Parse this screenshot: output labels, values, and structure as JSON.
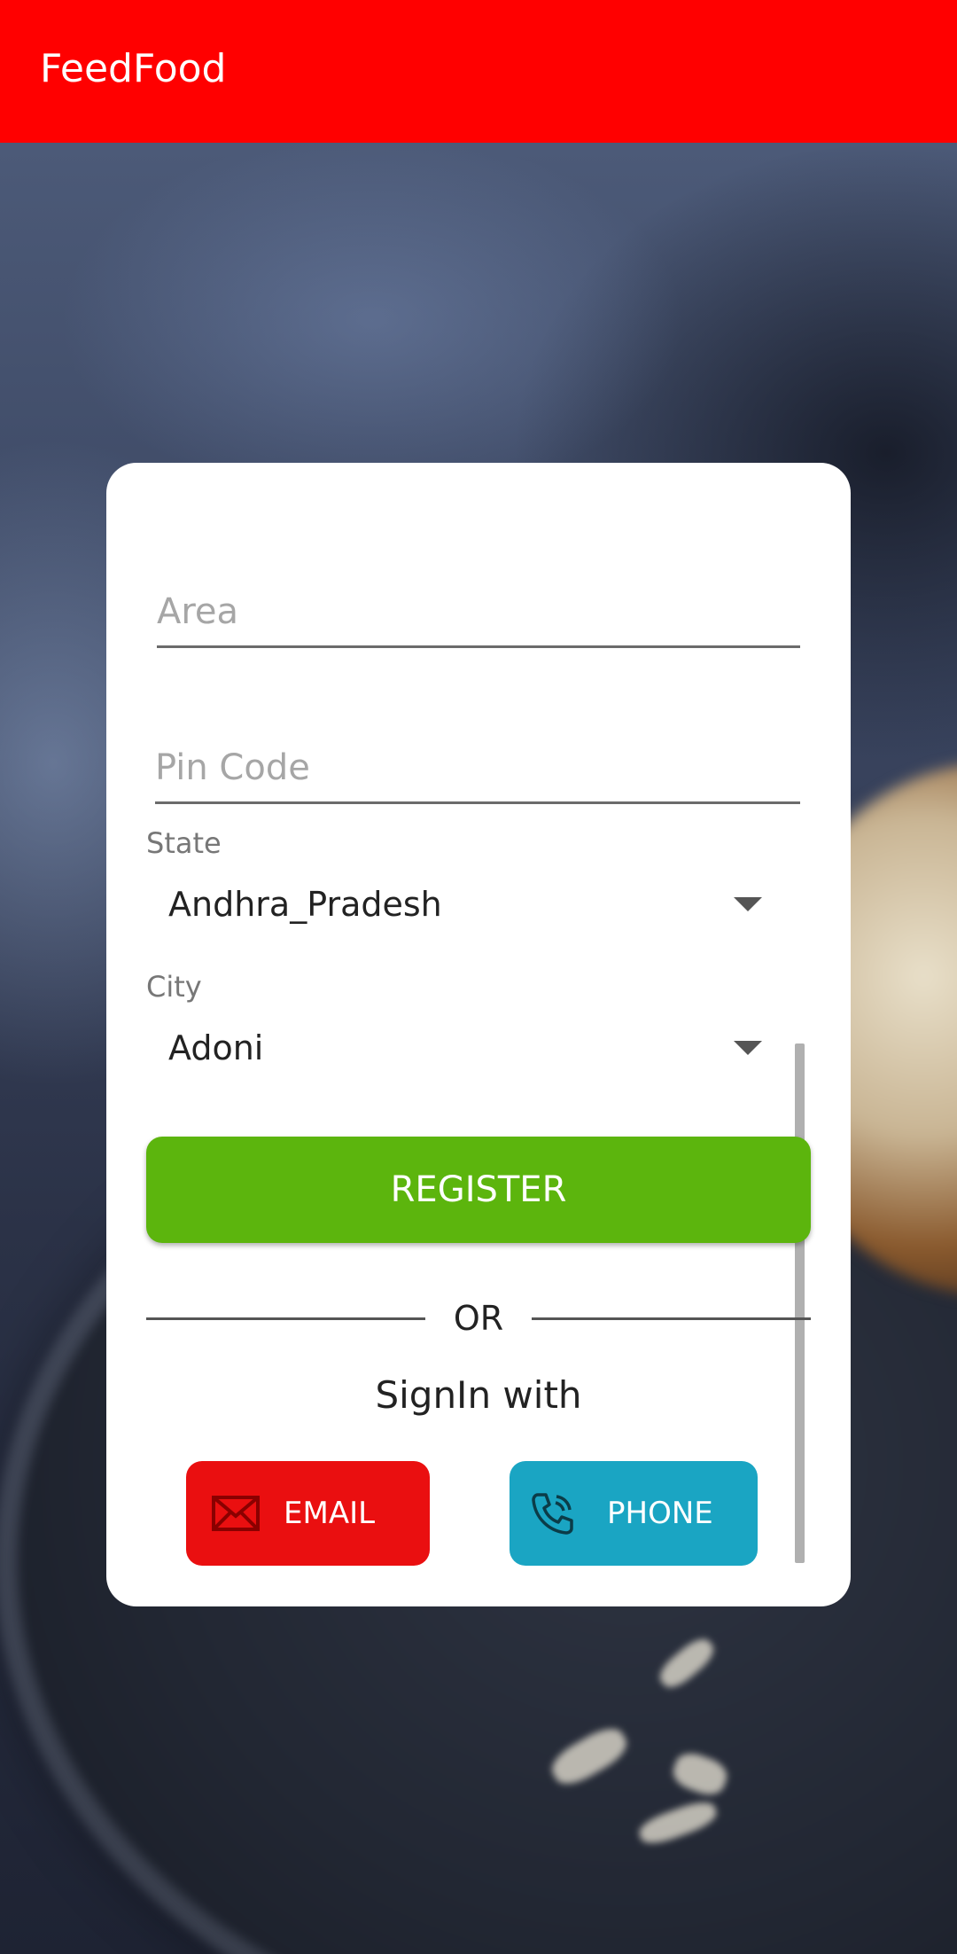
{
  "app_bar": {
    "title": "FeedFood",
    "color": "#ff0000"
  },
  "form": {
    "area": {
      "placeholder": "Area",
      "value": ""
    },
    "pin_code": {
      "placeholder": "Pin Code",
      "value": ""
    },
    "state": {
      "label": "State",
      "selected": "Andhra_Pradesh",
      "icon": "dropdown-arrow-icon"
    },
    "city": {
      "label": "City",
      "selected": "Adoni",
      "icon": "dropdown-arrow-icon"
    },
    "register_label": "REGISTER",
    "register_color": "#5cb50d"
  },
  "divider": {
    "or_text": "OR"
  },
  "signin": {
    "text": "SignIn with",
    "email": {
      "label": "EMAIL",
      "icon": "envelope-icon",
      "color": "#ea0f10"
    },
    "phone": {
      "label": "PHONE",
      "icon": "phone-icon",
      "color": "#1aa5c3"
    }
  }
}
